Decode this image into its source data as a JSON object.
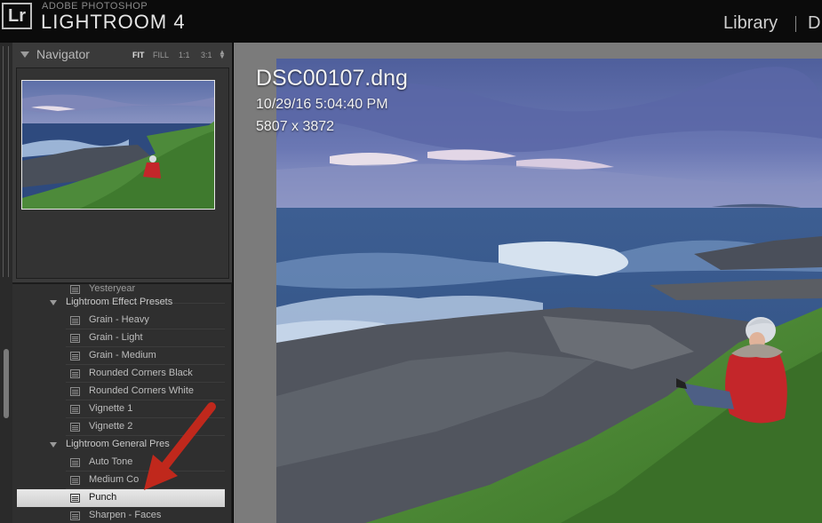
{
  "app": {
    "brand_small": "ADOBE PHOTOSHOP",
    "brand_big": "LIGHTROOM 4",
    "logo": "Lr"
  },
  "modules": {
    "library": "Library",
    "develop_partial": "D"
  },
  "navigator": {
    "title": "Navigator",
    "zoom": {
      "fit": "FIT",
      "fill": "FILL",
      "one_to_one": "1:1",
      "three_to_one": "3:1"
    }
  },
  "presets": {
    "partial_item": "Yesteryear",
    "folders": [
      {
        "name": "Lightroom Effect Presets",
        "items": [
          "Grain - Heavy",
          "Grain - Light",
          "Grain - Medium",
          "Rounded Corners Black",
          "Rounded Corners White",
          "Vignette 1",
          "Vignette 2"
        ]
      },
      {
        "name": "Lightroom General Pres",
        "items": [
          "Auto Tone",
          "Medium Co",
          "Punch",
          "Sharpen - Faces"
        ]
      }
    ],
    "selected": "Punch"
  },
  "photo_info": {
    "filename": "DSC00107.dng",
    "datetime": "10/29/16 5:04:40 PM",
    "dimensions": "5807 x 3872"
  },
  "colors": {
    "annotation_arrow": "#c0281c",
    "selected_row": "#dcdcdc"
  }
}
